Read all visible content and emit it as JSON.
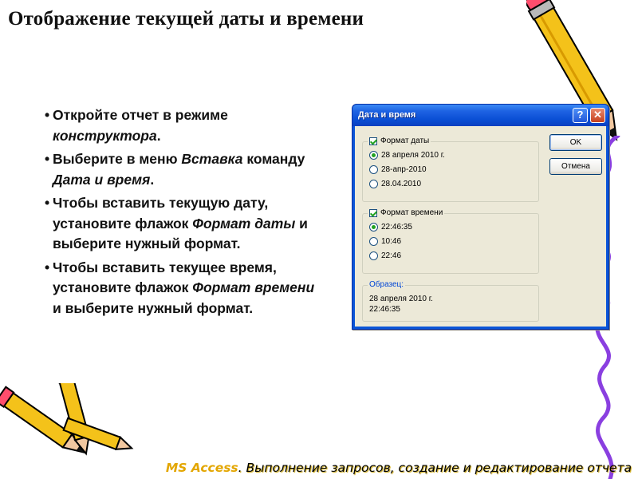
{
  "title": "Отображение текущей даты и времени",
  "bullets": [
    {
      "a": "Откройте отчет в режиме ",
      "em": "конструктора",
      "b": "."
    },
    {
      "a": "Выберите в меню ",
      "em": "Вставка",
      "b": " команду ",
      "em2": "Дата и время",
      "c": "."
    },
    {
      "a": "Чтобы вставить текущую дату, установите флажок ",
      "em": "Формат даты",
      "b": " и выберите нужный формат."
    },
    {
      "a": "Чтобы вставить текущее время, установите флажок ",
      "em": "Формат времени",
      "b": " и выберите нужный формат."
    }
  ],
  "dialog": {
    "title": "Дата и время",
    "help_label": "?",
    "close_label": "✕",
    "date_group": {
      "label": "Формат даты",
      "checked": true,
      "options": [
        "28 апреля 2010 г.",
        "28-апр-2010",
        "28.04.2010"
      ],
      "selected": 0
    },
    "time_group": {
      "label": "Формат времени",
      "checked": true,
      "options": [
        "22:46:35",
        "10:46",
        "22:46"
      ],
      "selected": 0
    },
    "sample": {
      "label": "Образец:",
      "line1": "28 апреля 2010 г.",
      "line2": "22:46:35"
    },
    "ok_label": "OK",
    "cancel_label": "Отмена"
  },
  "footer": {
    "prefix": "MS Access",
    "text": ". Выполнение запросов, создание и редактирование отчета"
  },
  "colors": {
    "titlebar": "#0a55d8",
    "dialog_bg": "#ece9d8",
    "pencil_body": "#f4c21a",
    "squiggle": "#8a3fe0",
    "footer_accent": "#e3a600"
  },
  "icons": [
    "help-icon",
    "close-icon",
    "pencil-icon",
    "squiggle-decoration"
  ]
}
